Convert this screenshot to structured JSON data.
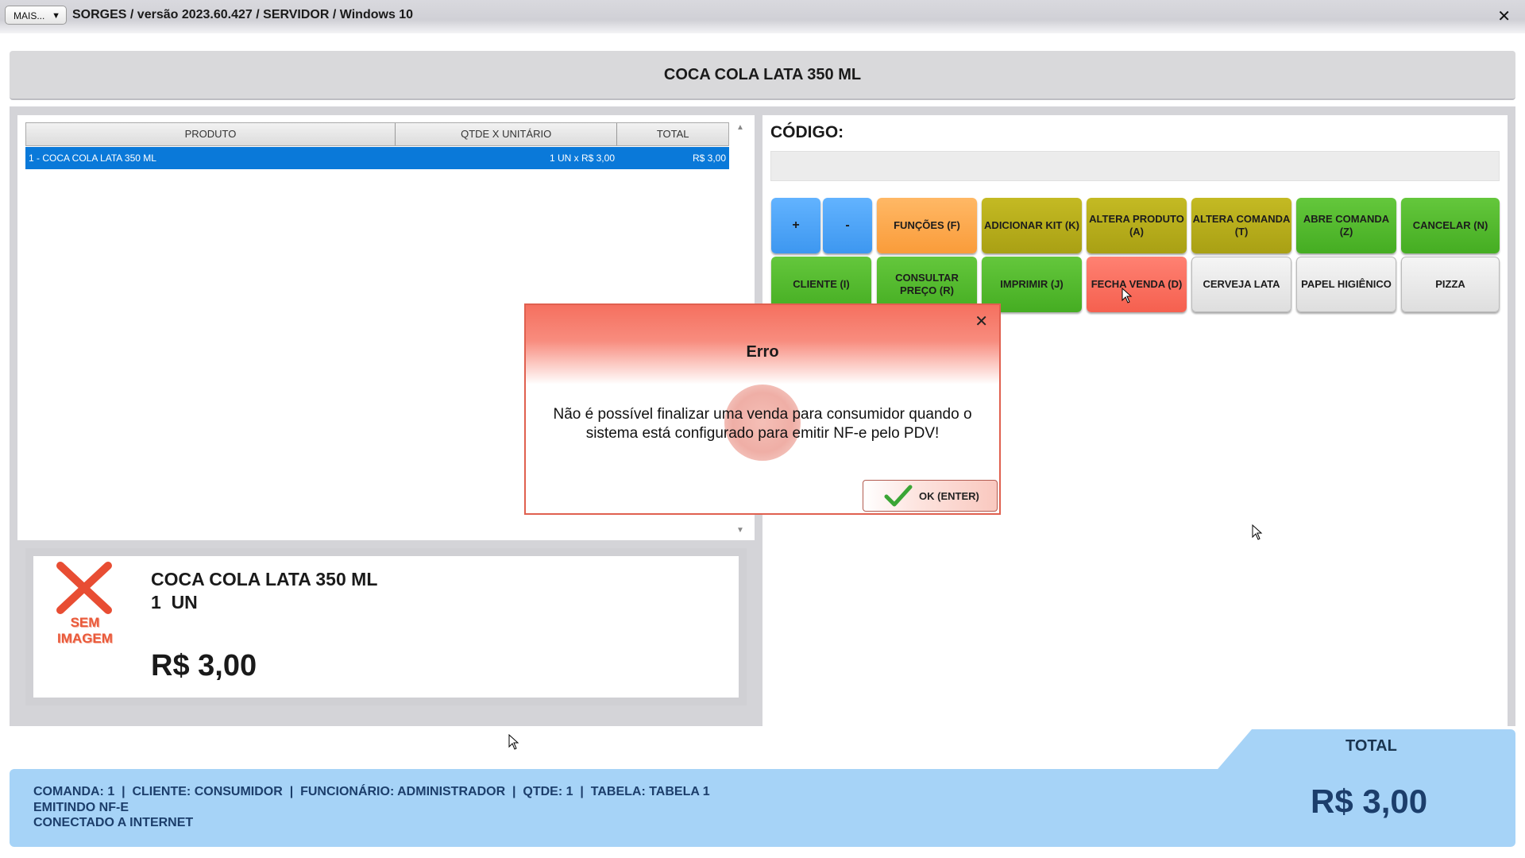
{
  "window": {
    "menu_button": "MAIS...",
    "menu_arrow": "▼",
    "title": "SORGES / versão 2023.60.427 / SERVIDOR / Windows 10",
    "close": "✕"
  },
  "banner": {
    "product": "COCA COLA LATA 350 ML"
  },
  "table": {
    "headers": [
      "PRODUTO",
      "QTDE X UNITÁRIO",
      "TOTAL"
    ],
    "rows": [
      {
        "produto": "1 - COCA COLA LATA 350 ML",
        "qtde": "1 UN x R$ 3,00",
        "total": "R$ 3,00"
      }
    ]
  },
  "detail": {
    "no_image_line1": "SEM",
    "no_image_line2": "IMAGEM",
    "name": "COCA COLA LATA 350 ML",
    "qty": "1  UN",
    "price": "R$ 3,00"
  },
  "code": {
    "label": "CÓDIGO:",
    "value": ""
  },
  "buttons": {
    "plus": "+",
    "minus": "-",
    "funcoes": "FUNÇÕES (F)",
    "adicionar_kit": "ADICIONAR KIT (K)",
    "altera_produto": "ALTERA PRODUTO (A)",
    "altera_comanda": "ALTERA COMANDA (T)",
    "abre_comanda": "ABRE COMANDA (Z)",
    "cancelar": "CANCELAR (N)",
    "cliente": "CLIENTE (I)",
    "consultar_preco": "CONSULTAR PREÇO (R)",
    "imprimir": "IMPRIMIR (J)",
    "fecha_venda": "FECHA VENDA (D)",
    "cerveja_lata": "CERVEJA LATA",
    "papel_higienico": "PAPEL HIGIÊNICO",
    "pizza": "PIZZA"
  },
  "colors": {
    "blue": "#4aa4f5",
    "orange": "#fba84c",
    "olive": "#b6ad1a",
    "green": "#52b92d",
    "red": "#f76c5c",
    "selection": "#0a79d9",
    "status_bg": "#a6d3f7"
  },
  "dialog": {
    "title": "Erro",
    "close": "✕",
    "message": "Não é possível finalizar uma venda para consumidor quando o sistema está configurado para emitir NF-e pelo PDV!",
    "ok_label": "OK (ENTER)",
    "ok_icon": "checkmark-icon",
    "watermark_icon": "error-icon"
  },
  "status": {
    "line1": "COMANDA: 1  |  CLIENTE: CONSUMIDOR  |  FUNCIONÁRIO: ADMINISTRADOR  |  QTDE: 1  |  TABELA: TABELA 1",
    "line2": "EMITINDO NF-E",
    "line3": "CONECTADO A INTERNET",
    "total_label": "TOTAL",
    "total_value": "R$ 3,00"
  }
}
